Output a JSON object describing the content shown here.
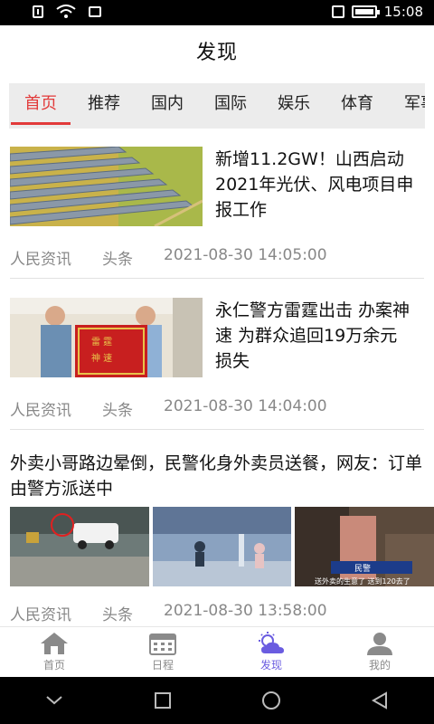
{
  "status_bar": {
    "time": "15:08"
  },
  "header": {
    "title": "发现"
  },
  "tabs": [
    {
      "label": "首页",
      "active": true
    },
    {
      "label": "推荐"
    },
    {
      "label": "国内"
    },
    {
      "label": "国际"
    },
    {
      "label": "娱乐"
    },
    {
      "label": "体育"
    },
    {
      "label": "军事"
    }
  ],
  "feed": [
    {
      "title": "新增11.2GW！山西启动2021年光伏、风电项目申报工作",
      "source": "人民资讯",
      "tag": "头条",
      "time": "2021-08-30 14:05:00",
      "image": "solar-panels-image"
    },
    {
      "title": "永仁警方雷霆出击 办案神速 为群众追回19万余元损失",
      "source": "人民资讯",
      "tag": "头条",
      "time": "2021-08-30 14:04:00",
      "image": "police-banner-image"
    },
    {
      "title": "外卖小哥路边晕倒，民警化身外卖员送餐，网友：订单由警方派送中",
      "source": "人民资讯",
      "tag": "头条",
      "time": "2021-08-30 13:58:00",
      "image_captions": [
        "民警",
        "送外卖的生意了 送到120去了"
      ]
    }
  ],
  "bottom_nav": [
    {
      "label": "首页",
      "icon": "home-icon"
    },
    {
      "label": "日程",
      "icon": "calendar-icon"
    },
    {
      "label": "发现",
      "icon": "weather-icon",
      "active": true
    },
    {
      "label": "我的",
      "icon": "user-icon"
    }
  ],
  "colors": {
    "accent_red": "#e23a3a",
    "active_nav": "#6a5ce0",
    "meta_gray": "#888888"
  }
}
